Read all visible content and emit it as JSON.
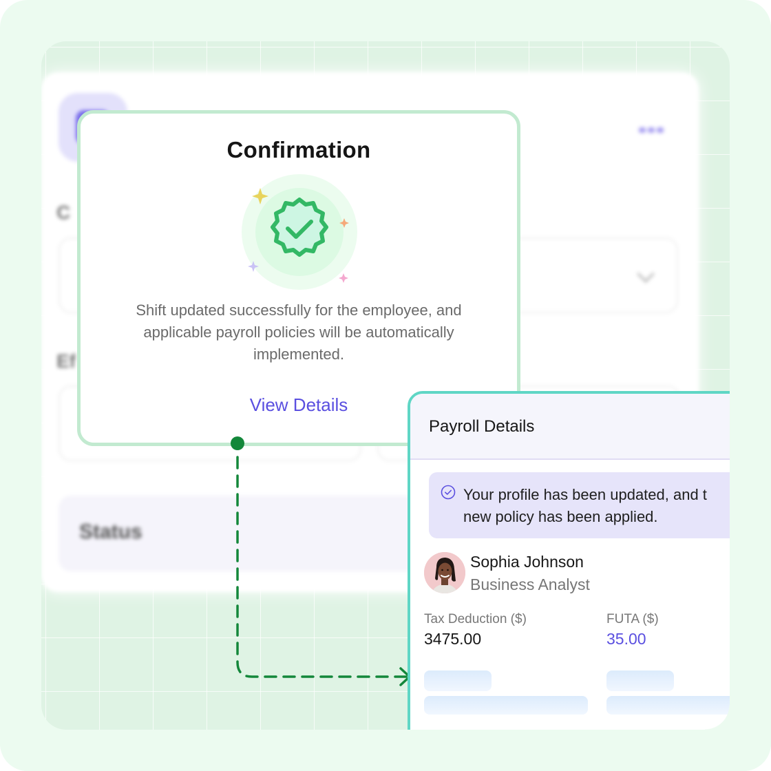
{
  "background_form": {
    "field_labels": [
      "C",
      "Ef"
    ],
    "status_label": "Status",
    "menu_icon": "more-dots-icon",
    "select_icon": "chevron-down-icon"
  },
  "confirmation": {
    "title": "Confirmation",
    "icon": "verified-badge-check-icon",
    "message": "Shift updated successfully for the employee, and applicable payroll policies will be automatically implemented.",
    "link_label": "View Details",
    "colors": {
      "border": "#c2ead0",
      "badge": "#33b865",
      "link": "#5a4fe0"
    }
  },
  "connector": {
    "color": "#13873a",
    "icon": "arrow-right-icon"
  },
  "payroll": {
    "title": "Payroll Details",
    "alert": {
      "icon": "check-circle-icon",
      "line1": "Your profile has been updated, and t",
      "line2": "new policy has been applied."
    },
    "employee": {
      "name": "Sophia Johnson",
      "role": "Business Analyst"
    },
    "fields": [
      {
        "label": "Tax Deduction ($)",
        "value": "3475.00"
      },
      {
        "label": "FUTA ($)",
        "value": "35.00"
      }
    ],
    "colors": {
      "border": "#5fd6c5",
      "accent": "#5a4fe0",
      "alert_bg": "#e6e4fa"
    }
  }
}
